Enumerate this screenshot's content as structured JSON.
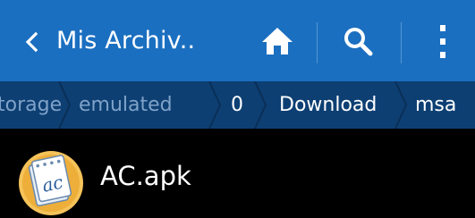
{
  "action_bar": {
    "title": "Mis Archiv..",
    "back_icon": "chevron-left-icon",
    "home_icon": "home-icon",
    "search_icon": "search-icon",
    "more_icon": "more-vertical-icon",
    "background_color": "#1b6fc0"
  },
  "breadcrumb": {
    "items": [
      {
        "label": "torage"
      },
      {
        "label": "emulated"
      },
      {
        "label": "0"
      },
      {
        "label": "Download"
      },
      {
        "label": "msa"
      }
    ],
    "background_color": "#0d3f73"
  },
  "files": [
    {
      "name": "AC.apk",
      "icon": "apk-file-icon",
      "icon_text": "ac"
    }
  ]
}
